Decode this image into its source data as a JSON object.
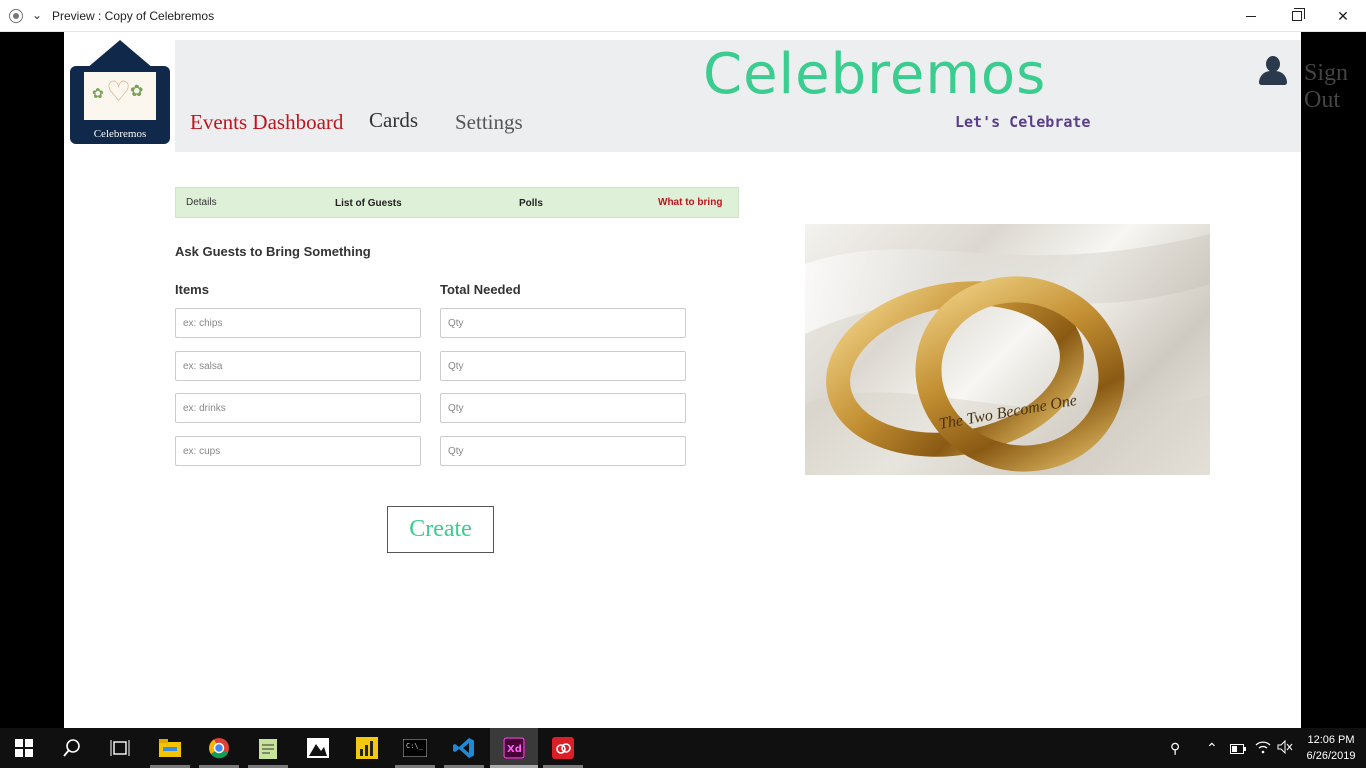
{
  "window": {
    "title": "Preview : Copy of Celebremos"
  },
  "header": {
    "logo_text": "Celebremos",
    "brand": "Celebremos",
    "tagline": "Let's Celebrate",
    "sign_out": "Sign Out",
    "nav": {
      "events": "Events Dashboard",
      "cards": "Cards",
      "settings": "Settings"
    }
  },
  "tabs": {
    "details": "Details",
    "guests": "List of Guests",
    "polls": "Polls",
    "bring": "What to bring",
    "active": "What to bring"
  },
  "form": {
    "title": "Ask Guests to Bring Something",
    "items_header": "Items",
    "total_header": "Total Needed",
    "rows": [
      {
        "item_placeholder": "ex: chips",
        "qty_placeholder": "Qty"
      },
      {
        "item_placeholder": "ex: salsa",
        "qty_placeholder": "Qty"
      },
      {
        "item_placeholder": "ex: drinks",
        "qty_placeholder": "Qty"
      },
      {
        "item_placeholder": "ex: cups",
        "qty_placeholder": "Qty"
      }
    ],
    "create_label": "Create"
  },
  "image": {
    "engraving": "The Two Become One"
  },
  "taskbar": {
    "time": "12:06 PM",
    "date": "6/26/2019",
    "apps": [
      "start-icon",
      "search-icon",
      "task-view-icon",
      "file-explorer-icon",
      "chrome-icon",
      "notepad-icon",
      "photos-icon",
      "power-bi-icon",
      "terminal-icon",
      "vscode-icon",
      "adobe-xd-icon",
      "creative-cloud-icon"
    ]
  },
  "colors": {
    "brand": "#3bcc8f",
    "active_nav": "#c0141d",
    "tagline": "#5a3e8c",
    "tab_bar": "#dff0d8",
    "header_bg": "#edeef0"
  }
}
